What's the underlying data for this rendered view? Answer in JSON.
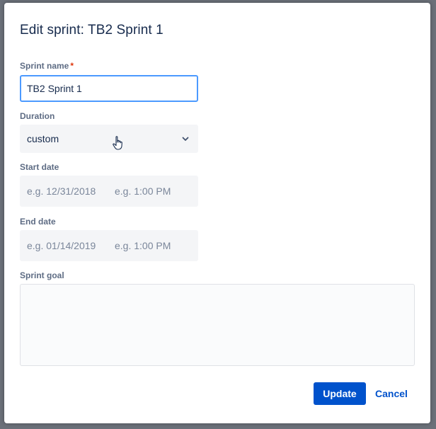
{
  "dialog": {
    "title": "Edit sprint: TB2 Sprint 1"
  },
  "sprint_name": {
    "label": "Sprint name",
    "required_marker": "*",
    "value": "TB2 Sprint 1"
  },
  "duration": {
    "label": "Duration",
    "selected": "custom"
  },
  "start_date": {
    "label": "Start date",
    "date_placeholder": "e.g. 12/31/2018",
    "time_placeholder": "e.g. 1:00 PM"
  },
  "end_date": {
    "label": "End date",
    "date_placeholder": "e.g. 01/14/2019",
    "time_placeholder": "e.g. 1:00 PM"
  },
  "sprint_goal": {
    "label": "Sprint goal",
    "value": ""
  },
  "actions": {
    "update_label": "Update",
    "cancel_label": "Cancel"
  },
  "colors": {
    "primary": "#0052cc",
    "focus_border": "#4c9aff",
    "required": "#de350b",
    "field_bg": "#f4f5f7"
  }
}
